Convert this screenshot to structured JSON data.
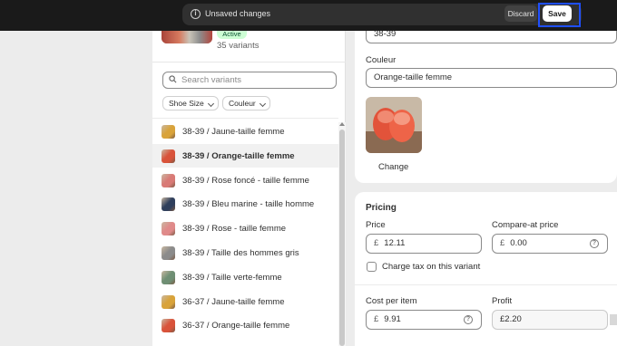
{
  "save_bar": {
    "message": "Unsaved changes",
    "info_icon": "i",
    "discard_label": "Discard",
    "save_label": "Save"
  },
  "product": {
    "status": "Active",
    "variant_count": "35 variants"
  },
  "search": {
    "placeholder": "Search variants"
  },
  "filters": [
    {
      "label": "Shoe Size"
    },
    {
      "label": "Couleur"
    }
  ],
  "variants": [
    {
      "label": "38-39 / Jaune-taille femme",
      "color": "#d9a33a",
      "selected": false
    },
    {
      "label": "38-39 / Orange-taille femme",
      "color": "#d9533a",
      "selected": true
    },
    {
      "label": "38-39 / Rose foncé - taille femme",
      "color": "#d97a76",
      "selected": false
    },
    {
      "label": "38-39 / Bleu marine - taille homme",
      "color": "#2f3f5c",
      "selected": false
    },
    {
      "label": "38-39 / Rose - taille femme",
      "color": "#e08a8a",
      "selected": false
    },
    {
      "label": "38-39 / Taille des hommes gris",
      "color": "#8b8b8b",
      "selected": false
    },
    {
      "label": "38-39 / Taille verte-femme",
      "color": "#6f8f74",
      "selected": false
    },
    {
      "label": "36-37 / Jaune-taille femme",
      "color": "#d9a33a",
      "selected": false
    },
    {
      "label": "36-37 / Orange-taille femme",
      "color": "#d9533a",
      "selected": false
    }
  ],
  "options": {
    "size_value": "38-39",
    "color_label": "Couleur",
    "color_value": "Orange-taille femme",
    "change_label": "Change"
  },
  "pricing": {
    "title": "Pricing",
    "price_label": "Price",
    "price_currency": "£",
    "price_value": "12.11",
    "compare_label": "Compare-at price",
    "compare_currency": "£",
    "compare_value": "0.00",
    "tax_label": "Charge tax on this variant",
    "cost_label": "Cost per item",
    "cost_currency": "£",
    "cost_value": "9.91",
    "profit_label": "Profit",
    "profit_value": "£2.20"
  },
  "help_icon_glyph": "?"
}
